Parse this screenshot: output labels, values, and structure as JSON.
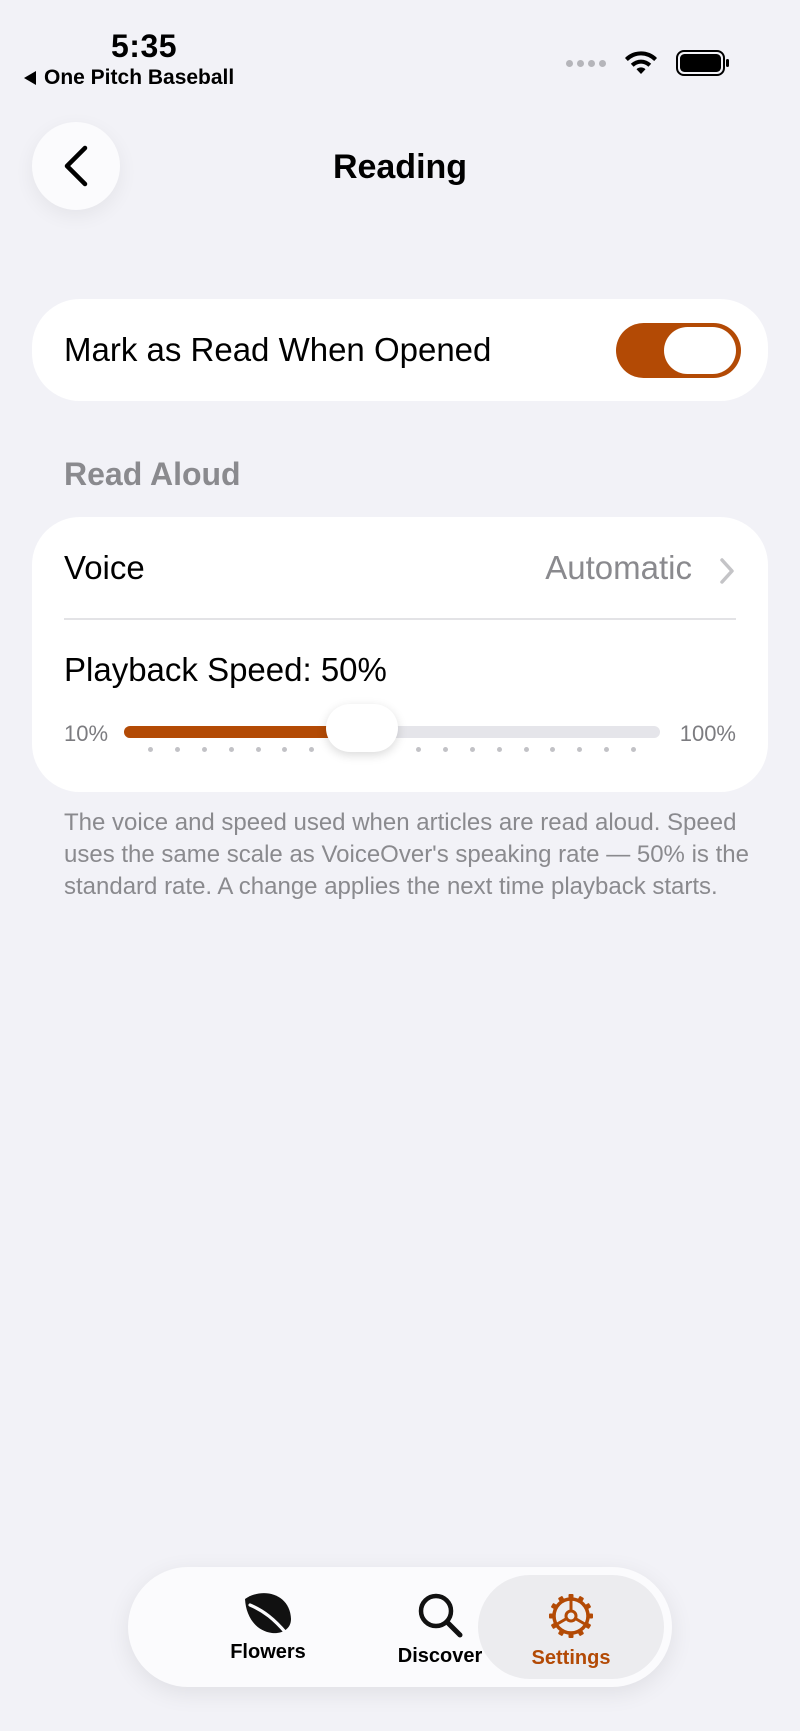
{
  "status_bar": {
    "time": "5:35",
    "back_app": "One Pitch Baseball"
  },
  "nav": {
    "title": "Reading"
  },
  "mark_as_read": {
    "label": "Mark as Read When Opened",
    "enabled": true
  },
  "read_aloud": {
    "header": "Read Aloud",
    "voice_label": "Voice",
    "voice_value": "Automatic",
    "speed_label": "Playback Speed: 50%",
    "speed_value": 50,
    "speed_min": 10,
    "speed_max": 100,
    "min_label": "10%",
    "max_label": "100%",
    "footnote": "The voice and speed used when articles are read aloud. Speed uses the same scale as VoiceOver's speaking rate — 50% is the standard rate. A change applies the next time playback starts."
  },
  "tabs": [
    {
      "label": "Flowers",
      "icon": "leaf-icon"
    },
    {
      "label": "Discover",
      "icon": "magnifier-icon"
    },
    {
      "label": "Settings",
      "icon": "gear-icon",
      "selected": true
    }
  ],
  "colors": {
    "accent": "#b34a05",
    "background": "#f2f2f7",
    "secondary_text": "#8a8a8e"
  }
}
